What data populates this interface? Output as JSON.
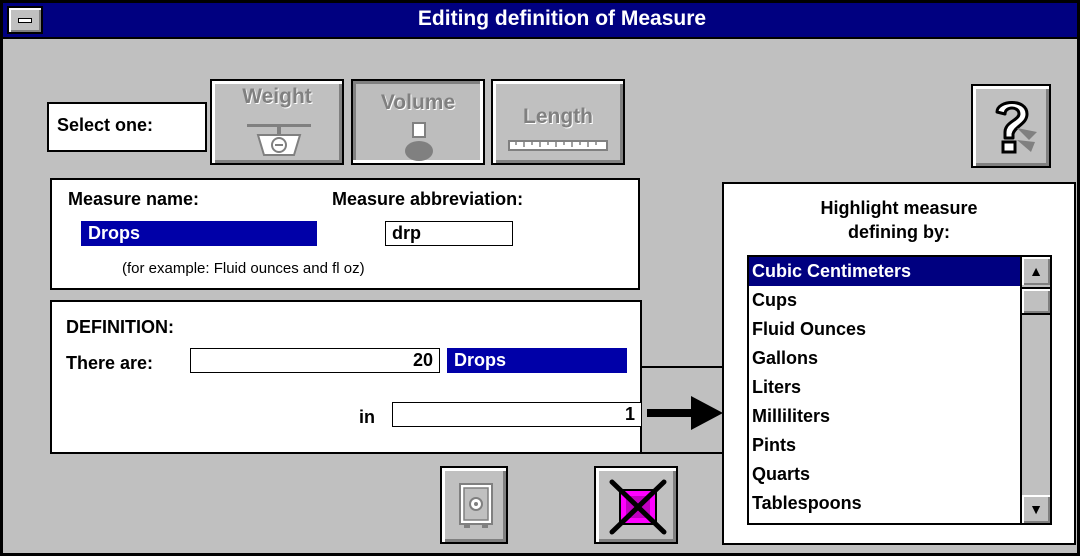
{
  "window": {
    "title": "Editing definition of Measure"
  },
  "selector": {
    "label": "Select one:",
    "options": [
      {
        "label": "Weight",
        "icon": "scale-icon",
        "pressed": false
      },
      {
        "label": "Volume",
        "icon": "flask-icon",
        "pressed": true
      },
      {
        "label": "Length",
        "icon": "ruler-icon",
        "pressed": false
      }
    ]
  },
  "help": {
    "icon": "help-question-icon"
  },
  "measure": {
    "name_label": "Measure name:",
    "name_value": "Drops",
    "abbrev_label": "Measure abbreviation:",
    "abbrev_value": "drp",
    "example": "(for example: Fluid ounces  and  fl oz)"
  },
  "definition": {
    "heading": "DEFINITION:",
    "there_are_label": "There are:",
    "count": "20",
    "unit": "Drops",
    "in_label": "in",
    "in_value": "1",
    "arrow_icon": "right-arrow-icon"
  },
  "measure_list": {
    "heading_line1": "Highlight measure",
    "heading_line2": "defining by:",
    "items": [
      "Cubic Centimeters",
      "Cups",
      "Fluid Ounces",
      "Gallons",
      "Liters",
      "Milliliters",
      "Pints",
      "Quarts",
      "Tablespoons"
    ],
    "selected_index": 0
  },
  "actions": {
    "save_icon": "safe-icon",
    "cancel_icon": "cancel-icon"
  },
  "colors": {
    "titlebar": "#000080",
    "selection": "#0000a8",
    "face": "#c0c0c0",
    "cancel_magenta": "#ff00ff"
  }
}
